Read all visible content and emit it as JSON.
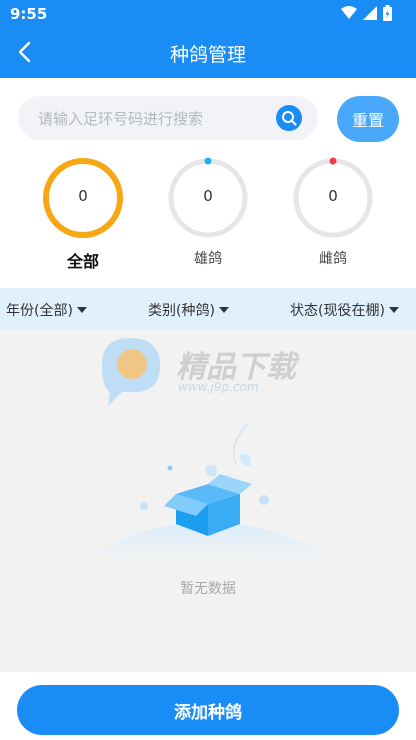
{
  "status_bar": {
    "time": "9:55",
    "icons": [
      "wifi-icon",
      "signal-icon",
      "battery-icon"
    ]
  },
  "header": {
    "title": "种鸽管理",
    "back_icon": "chevron-left-icon"
  },
  "search": {
    "placeholder": "请输入足环号码进行搜索",
    "reset_label": "重置"
  },
  "stats": [
    {
      "label": "全部",
      "value": "0",
      "active": true,
      "color": "#f7a714"
    },
    {
      "label": "雄鸽",
      "value": "0",
      "active": false,
      "color": "#1a8cf5"
    },
    {
      "label": "雌鸽",
      "value": "0",
      "active": false,
      "color": "#f23a4a"
    }
  ],
  "filters": [
    {
      "label": "年份(全部)"
    },
    {
      "label": "类别(种鸽)"
    },
    {
      "label": "状态(现役在棚)"
    }
  ],
  "watermark": {
    "brand": "精品下载",
    "url": "www.j9p.com"
  },
  "empty_state": {
    "text": "暂无数据"
  },
  "footer": {
    "add_label": "添加种鸽"
  },
  "colors": {
    "primary": "#1a8cf5",
    "filter_bg": "#e0f1fd",
    "ring_track": "#e6e6e6"
  }
}
